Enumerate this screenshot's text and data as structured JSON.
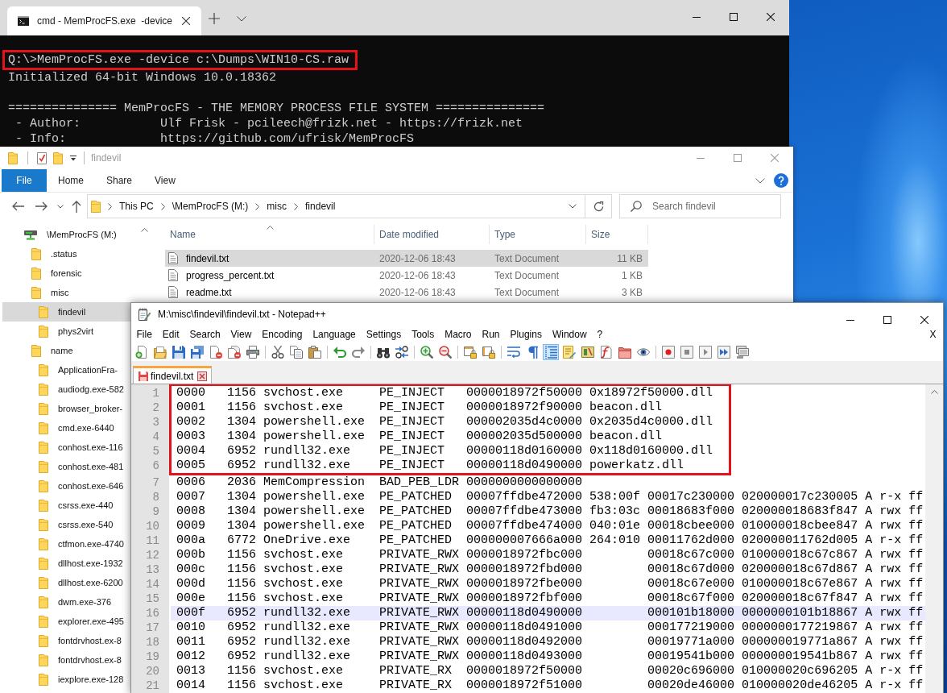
{
  "cmd_window": {
    "tab_title": "cmd - MemProcFS.exe  -device",
    "console": [
      [
        {
          "text": "Q:\\>MemProcFS.exe -device c:\\Dumps\\WIN10-CS.raw",
          "highlighted": true
        },
        {
          "text": "Initialized 64-bit Windows 10.0.18362",
          "highlighted": false
        }
      ],
      [
        {
          "text": "=============== MemProcFS - THE MEMORY PROCESS FILE SYSTEM ===============",
          "highlighted": false
        },
        {
          "text": " - Author:           Ulf Frisk - pcileech@frizk.net - https://frizk.net",
          "highlighted": false
        },
        {
          "text": " - Info:             https://github.com/ufrisk/MemProcFS",
          "highlighted": false
        }
      ]
    ]
  },
  "explorer": {
    "title": "findevil",
    "ribbon": {
      "file_tab": "File",
      "tabs": [
        "Home",
        "Share",
        "View"
      ]
    },
    "address": [
      "This PC",
      "\\MemProcFS (M:)",
      "misc",
      "findevil"
    ],
    "search": {
      "placeholder": "Search findevil"
    },
    "navigation": [
      {
        "label": "\\MemProcFS (M:)",
        "kind": "drive",
        "selected": false,
        "children": [
          {
            "label": ".status",
            "kind": "folder",
            "selected": false
          },
          {
            "label": "forensic",
            "kind": "folder",
            "selected": false
          },
          {
            "label": "misc",
            "kind": "folder",
            "selected": false,
            "children": [
              {
                "label": "findevil",
                "kind": "folder",
                "selected": true
              },
              {
                "label": "phys2virt",
                "kind": "folder",
                "selected": false
              }
            ]
          },
          {
            "label": "name",
            "kind": "folder",
            "selected": false,
            "children": [
              {
                "label": "ApplicationFra-",
                "kind": "folder",
                "selected": false
              },
              {
                "label": "audiodg.exe-582",
                "kind": "folder",
                "selected": false
              },
              {
                "label": "browser_broker-",
                "kind": "folder",
                "selected": false
              },
              {
                "label": "cmd.exe-6440",
                "kind": "folder",
                "selected": false
              },
              {
                "label": "conhost.exe-116",
                "kind": "folder",
                "selected": false
              },
              {
                "label": "conhost.exe-481",
                "kind": "folder",
                "selected": false
              },
              {
                "label": "conhost.exe-646",
                "kind": "folder",
                "selected": false
              },
              {
                "label": "csrss.exe-440",
                "kind": "folder",
                "selected": false
              },
              {
                "label": "csrss.exe-540",
                "kind": "folder",
                "selected": false
              },
              {
                "label": "ctfmon.exe-4740",
                "kind": "folder",
                "selected": false
              },
              {
                "label": "dllhost.exe-1932",
                "kind": "folder",
                "selected": false
              },
              {
                "label": "dllhost.exe-6200",
                "kind": "folder",
                "selected": false
              },
              {
                "label": "dwm.exe-376",
                "kind": "folder",
                "selected": false
              },
              {
                "label": "explorer.exe-495",
                "kind": "folder",
                "selected": false
              },
              {
                "label": "fontdrvhost.ex-8",
                "kind": "folder",
                "selected": false
              },
              {
                "label": "fontdrvhost.ex-8",
                "kind": "folder",
                "selected": false
              },
              {
                "label": "iexplore.exe-128",
                "kind": "folder",
                "selected": false
              }
            ]
          }
        ]
      }
    ],
    "columns": [
      {
        "label": "Name",
        "sorted": true
      },
      {
        "label": "Date modified",
        "sorted": false
      },
      {
        "label": "Type",
        "sorted": false
      },
      {
        "label": "Size",
        "sorted": false
      }
    ],
    "files": [
      {
        "name": "findevil.txt",
        "modified": "2020-12-06 18:43",
        "type": "Text Document",
        "size": "11 KB",
        "selected": true
      },
      {
        "name": "progress_percent.txt",
        "modified": "2020-12-06 18:43",
        "type": "Text Document",
        "size": "1 KB",
        "selected": false
      },
      {
        "name": "readme.txt",
        "modified": "2020-12-06 18:43",
        "type": "Text Document",
        "size": "3 KB",
        "selected": false
      }
    ]
  },
  "notepad": {
    "title": "M:\\misc\\findevil\\findevil.txt - Notepad++",
    "menu": [
      "File",
      "Edit",
      "Search",
      "View",
      "Encoding",
      "Language",
      "Settings",
      "Tools",
      "Macro",
      "Run",
      "Plugins",
      "Window",
      "?"
    ],
    "close_document": "X",
    "toolbar": [
      [
        {
          "kind": "new",
          "pressed": false
        },
        {
          "kind": "open",
          "pressed": false
        },
        {
          "kind": "save",
          "pressed": false
        },
        {
          "kind": "saveall",
          "pressed": false
        },
        {
          "kind": "close",
          "pressed": false
        },
        {
          "kind": "closeall",
          "pressed": false
        },
        {
          "kind": "print",
          "pressed": false
        }
      ],
      [
        {
          "kind": "cut",
          "pressed": false
        },
        {
          "kind": "copy",
          "pressed": false
        },
        {
          "kind": "paste",
          "pressed": false
        }
      ],
      [
        {
          "kind": "undo",
          "pressed": false
        },
        {
          "kind": "redo",
          "pressed": false
        }
      ],
      [
        {
          "kind": "find",
          "pressed": false
        },
        {
          "kind": "replace",
          "pressed": false
        }
      ],
      [
        {
          "kind": "zoomin",
          "pressed": false
        },
        {
          "kind": "zoomout",
          "pressed": false
        }
      ],
      [
        {
          "kind": "syncv",
          "pressed": false
        },
        {
          "kind": "synch",
          "pressed": false
        }
      ],
      [
        {
          "kind": "wrap",
          "pressed": false
        },
        {
          "kind": "allchars",
          "pressed": false
        },
        {
          "kind": "indent",
          "pressed": true
        },
        {
          "kind": "language",
          "pressed": false
        },
        {
          "kind": "docmap",
          "pressed": false
        },
        {
          "kind": "functions",
          "pressed": false
        },
        {
          "kind": "workspace",
          "pressed": false
        },
        {
          "kind": "monitor",
          "pressed": false
        }
      ],
      [
        {
          "kind": "record",
          "pressed": false
        },
        {
          "kind": "stop",
          "pressed": false
        },
        {
          "kind": "play",
          "pressed": false
        },
        {
          "kind": "playmulti",
          "pressed": false
        },
        {
          "kind": "savemacro",
          "pressed": false
        }
      ]
    ],
    "tabs": [
      {
        "label": "findevil.txt",
        "selected": true
      }
    ],
    "line_groups": [
      {
        "kind": "boxed",
        "lines": [
          {
            "number": "1",
            "text": "0000   1156 svchost.exe     PE_INJECT   0000018972f50000 0x18972f50000.dll",
            "current": false
          },
          {
            "number": "2",
            "text": "0001   1156 svchost.exe     PE_INJECT   0000018972f90000 beacon.dll",
            "current": false
          },
          {
            "number": "3",
            "text": "0002   1304 powershell.exe  PE_INJECT   000002035d4c0000 0x2035d4c0000.dll",
            "current": false
          },
          {
            "number": "4",
            "text": "0003   1304 powershell.exe  PE_INJECT   000002035d500000 beacon.dll",
            "current": false
          },
          {
            "number": "5",
            "text": "0004   6952 rundll32.exe    PE_INJECT   00000118d0160000 0x118d0160000.dll",
            "current": false
          },
          {
            "number": "6",
            "text": "0005   6952 rundll32.exe    PE_INJECT   00000118d0490000 powerkatz.dll",
            "current": false
          }
        ]
      },
      {
        "kind": "plain",
        "lines": [
          {
            "number": "7",
            "text": "0006   2036 MemCompression  BAD_PEB_LDR 0000000000000000",
            "current": false
          },
          {
            "number": "8",
            "text": "0007   1304 powershell.exe  PE_PATCHED  00007ffdbe472000 538:00f 00017c230000 020000017c230005 A r-x ff",
            "current": false
          },
          {
            "number": "9",
            "text": "0008   1304 powershell.exe  PE_PATCHED  00007ffdbe473000 fb3:03c 00018683f000 020000018683f847 A rwx ff",
            "current": false
          },
          {
            "number": "10",
            "text": "0009   1304 powershell.exe  PE_PATCHED  00007ffdbe474000 040:01e 00018cbee000 010000018cbee847 A rwx ff",
            "current": false
          },
          {
            "number": "11",
            "text": "000a   6772 OneDrive.exe    PE_PATCHED  000000007666a000 264:010 00011762d000 020000011762d005 A r-x ff",
            "current": false
          },
          {
            "number": "12",
            "text": "000b   1156 svchost.exe     PRIVATE_RWX 0000018972fbc000         00018c67c000 010000018c67c867 A rwx ff",
            "current": false
          },
          {
            "number": "13",
            "text": "000c   1156 svchost.exe     PRIVATE_RWX 0000018972fbd000         00018c67d000 020000018c67d867 A rwx ff",
            "current": false
          },
          {
            "number": "14",
            "text": "000d   1156 svchost.exe     PRIVATE_RWX 0000018972fbe000         00018c67e000 010000018c67e867 A rwx ff",
            "current": false
          },
          {
            "number": "15",
            "text": "000e   1156 svchost.exe     PRIVATE_RWX 0000018972fbf000         00018c67f000 020000018c67f847 A rwx ff",
            "current": false
          },
          {
            "number": "16",
            "text": "000f   6952 rundll32.exe    PRIVATE_RWX 00000118d0490000         000101b18000 0000000101b18867 A rwx ff",
            "current": true
          },
          {
            "number": "17",
            "text": "0010   6952 rundll32.exe    PRIVATE_RWX 00000118d0491000         000177219000 0000000177219867 A rwx ff",
            "current": false
          },
          {
            "number": "18",
            "text": "0011   6952 rundll32.exe    PRIVATE_RWX 00000118d0492000         00019771a000 000000019771a867 A rwx ff",
            "current": false
          },
          {
            "number": "19",
            "text": "0012   6952 rundll32.exe    PRIVATE_RWX 00000118d0493000         00019541b000 000000019541b867 A rwx ff",
            "current": false
          },
          {
            "number": "20",
            "text": "0013   1156 svchost.exe     PRIVATE_RX  0000018972f50000         00020c696000 010000020c696205 A r-x ff",
            "current": false
          },
          {
            "number": "21",
            "text": "0014   1156 svchost.exe     PRIVATE_RX  0000018972f51000         00020de46000 010000020de46205 A r-x ff",
            "current": false
          }
        ]
      }
    ]
  }
}
